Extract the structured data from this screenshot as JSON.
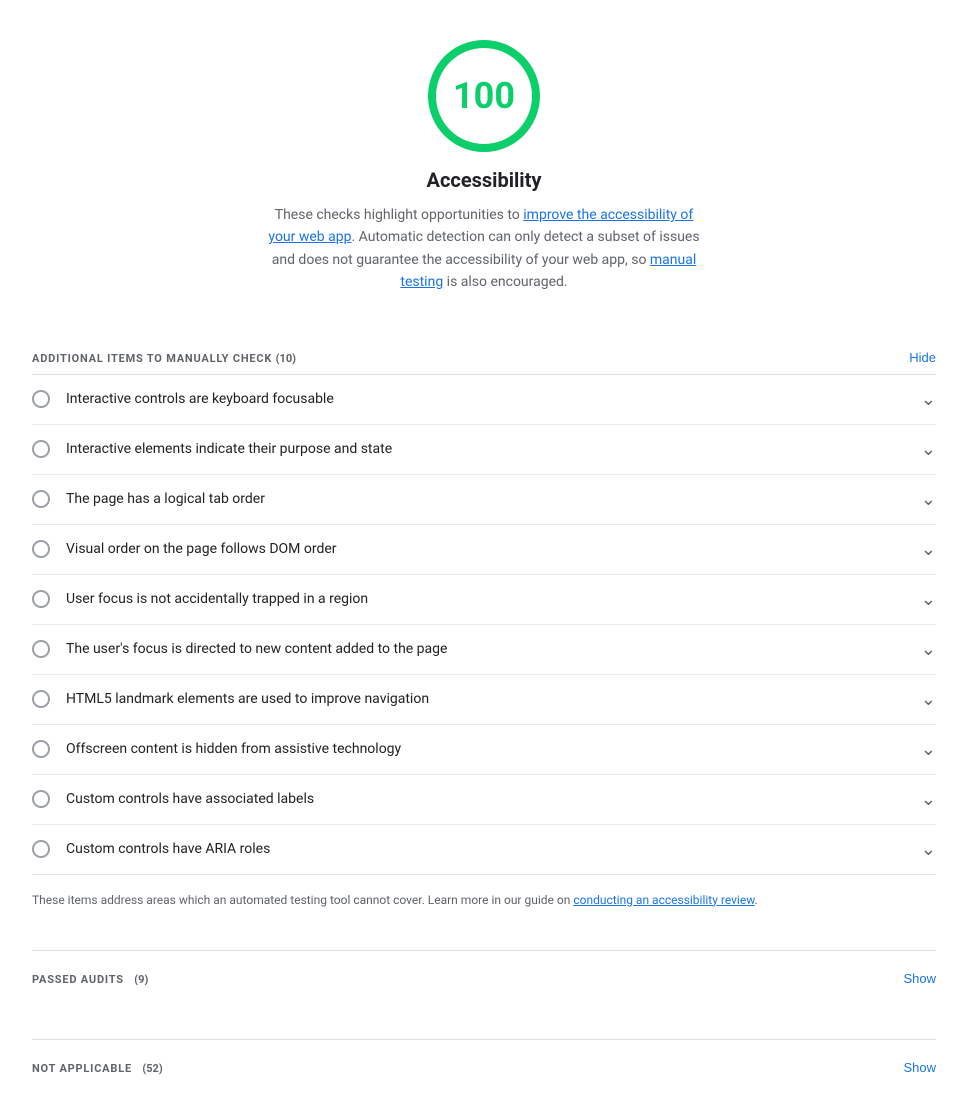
{
  "score": {
    "value": "100",
    "label": "Accessibility",
    "color": "#0cce6b",
    "description_before": "These checks highlight opportunities to ",
    "link1_text": "improve the accessibility of your web app",
    "link1_href": "#",
    "description_middle": ". Automatic detection can only detect a subset of issues and does not guarantee the accessibility of your web app, so ",
    "link2_text": "manual testing",
    "link2_href": "#",
    "description_after": " is also encouraged."
  },
  "manual_checks": {
    "section_label": "ADDITIONAL ITEMS TO MANUALLY CHECK",
    "count": "(10)",
    "toggle_label": "Hide",
    "items": [
      {
        "id": 1,
        "label": "Interactive controls are keyboard focusable"
      },
      {
        "id": 2,
        "label": "Interactive elements indicate their purpose and state"
      },
      {
        "id": 3,
        "label": "The page has a logical tab order"
      },
      {
        "id": 4,
        "label": "Visual order on the page follows DOM order"
      },
      {
        "id": 5,
        "label": "User focus is not accidentally trapped in a region"
      },
      {
        "id": 6,
        "label": "The user's focus is directed to new content added to the page"
      },
      {
        "id": 7,
        "label": "HTML5 landmark elements are used to improve navigation"
      },
      {
        "id": 8,
        "label": "Offscreen content is hidden from assistive technology"
      },
      {
        "id": 9,
        "label": "Custom controls have associated labels"
      },
      {
        "id": 10,
        "label": "Custom controls have ARIA roles"
      }
    ],
    "footer_before": "These items address areas which an automated testing tool cannot cover. Learn more in our guide on ",
    "footer_link_text": "conducting an accessibility review",
    "footer_link_href": "#",
    "footer_after": "."
  },
  "passed_audits": {
    "section_label": "PASSED AUDITS",
    "count": "(9)",
    "toggle_label": "Show"
  },
  "not_applicable": {
    "section_label": "NOT APPLICABLE",
    "count": "(52)",
    "toggle_label": "Show"
  }
}
